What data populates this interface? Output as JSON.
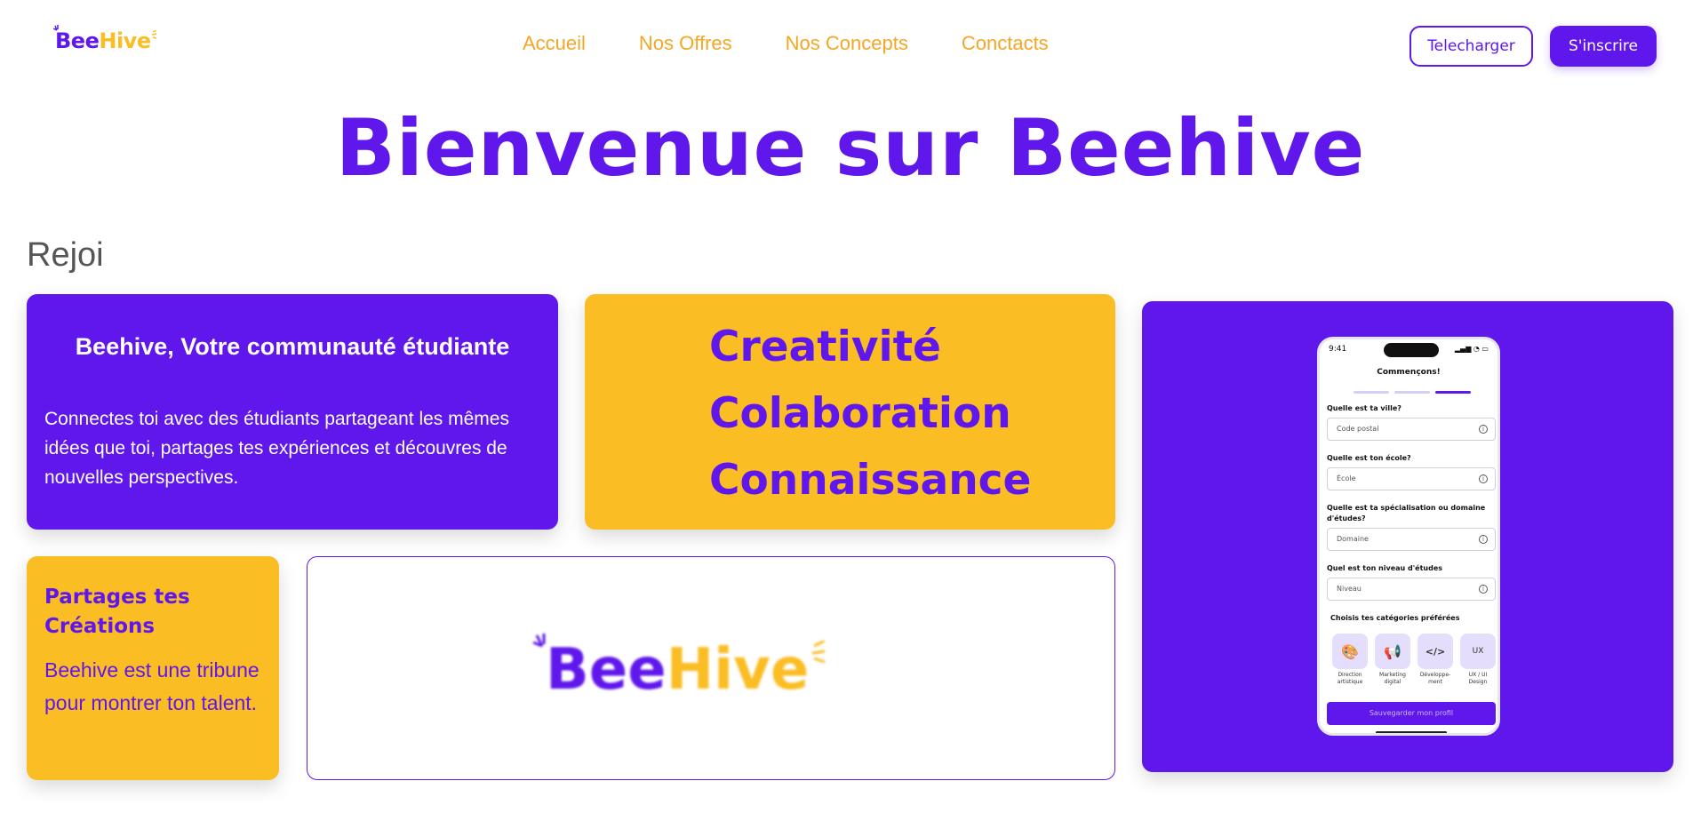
{
  "header": {
    "logo": {
      "bee": "Bee",
      "hive": "Hive"
    },
    "nav": [
      "Accueil",
      "Nos Offres",
      "Nos Concepts",
      "Conctacts"
    ],
    "download_label": "Telecharger",
    "signup_label": "S'inscrire"
  },
  "hero": {
    "title": "Bienvenue sur Beehive",
    "subtitle": "Rejoi"
  },
  "community_card": {
    "title": "Beehive, Votre communauté étudiante",
    "text": "Connectes toi avec des étudiants partageant les mêmes idées que toi, partages tes expériences et découvres de nouvelles perspectives."
  },
  "values_card": {
    "values": [
      "Creativité",
      "Colaboration",
      "Connaissance"
    ]
  },
  "share_card": {
    "title": "Partages tes Créations",
    "text": "Beehive est une tribune pour montrer ton talent."
  },
  "logo_card": {
    "bee": "Bee",
    "hive": "Hive"
  },
  "phone": {
    "time": "9:41",
    "title": "Commençons!",
    "questions": [
      {
        "label": "Quelle est ta ville?",
        "placeholder": "Code postal"
      },
      {
        "label": "Quelle est ton école?",
        "placeholder": "École"
      },
      {
        "label": "Quelle est ta spécialisation ou domaine d'études?",
        "placeholder": "Domaine"
      },
      {
        "label": "Quel est ton niveau d'études",
        "placeholder": "Niveau"
      }
    ],
    "categories_label": "Choisis tes catégories préférées",
    "categories": [
      {
        "label": "Direction artistique",
        "icon": "palette-icon",
        "glyph": "🎨"
      },
      {
        "label": "Marketing digital",
        "icon": "megaphone-icon",
        "glyph": "📢"
      },
      {
        "label": "Développe-ment",
        "icon": "code-icon",
        "glyph": "</>"
      },
      {
        "label": "UX / UI Design",
        "icon": "ux-icon",
        "glyph": "UX"
      }
    ],
    "save_label": "Sauvegarder mon profil"
  },
  "colors": {
    "primary": "#5f17eb",
    "accent": "#fbbd24",
    "nav": "#f5a623"
  }
}
